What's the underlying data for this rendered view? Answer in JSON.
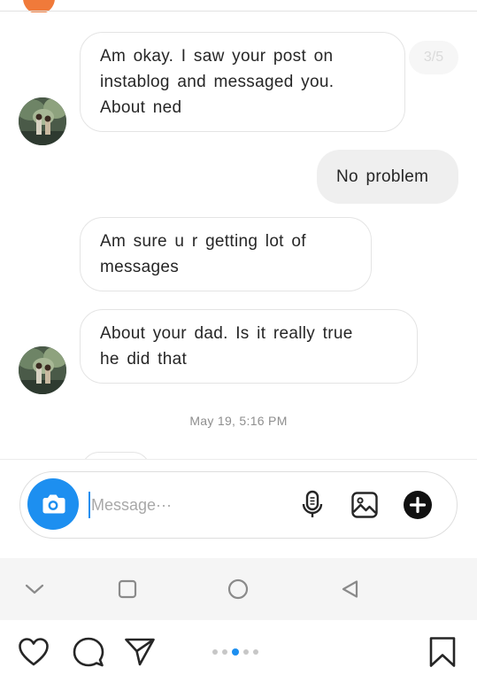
{
  "conversation": {
    "media_counter": "3/5",
    "messages": [
      {
        "direction": "incoming",
        "text": "Am okay. I saw your post on\ninstablog and messaged you.\nAbout ned"
      },
      {
        "direction": "outgoing",
        "text": "No problem"
      },
      {
        "direction": "incoming",
        "text": "Am sure u r getting lot of\nmessages"
      },
      {
        "direction": "incoming",
        "text": "About your dad. Is it really true\nhe did that"
      }
    ],
    "timestamp": "May 19, 5:16 PM"
  },
  "composer": {
    "placeholder": "Message···",
    "camera_icon": "camera-icon",
    "mic_icon": "microphone-icon",
    "gallery_icon": "gallery-icon",
    "add_icon": "plus-circle-icon"
  },
  "system_nav": {
    "icons": [
      "chevron-down-icon",
      "square-icon",
      "circle-icon",
      "triangle-back-icon"
    ]
  },
  "post_actions": {
    "icons": [
      "heart-icon",
      "comment-icon",
      "send-icon",
      "bookmark-icon"
    ],
    "carousel": {
      "count": 5,
      "active_index": 2
    },
    "accent_color": "#1d8ff0"
  }
}
